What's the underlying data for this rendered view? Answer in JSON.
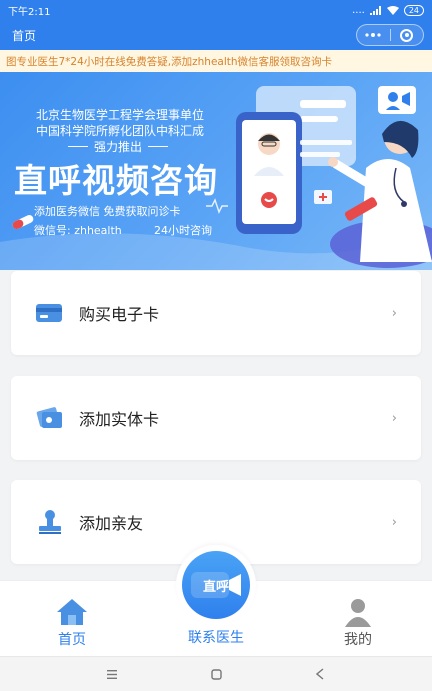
{
  "status_bar": {
    "time": "下午2:11",
    "signal": "....",
    "battery": "24"
  },
  "nav": {
    "title": "首页",
    "menu_label": "•••"
  },
  "marquee": {
    "text": "图专业医生7*24小时在线免费答疑,添加zhhealth微信客服领取咨询卡"
  },
  "banner": {
    "line1": "北京生物医学工程学会理事单位",
    "line2": "中国科学院所孵化团队中科汇成",
    "subtitle": "强力推出",
    "title": "直呼视频咨询",
    "line3": "添加医务微信 免费获取问诊卡",
    "line4": "微信号: zhhealth",
    "line5": "24小时咨询"
  },
  "menu": [
    {
      "label": "购买电子卡",
      "icon": "credit-card-icon"
    },
    {
      "label": "添加实体卡",
      "icon": "physical-card-icon"
    },
    {
      "label": "添加亲友",
      "icon": "stamp-icon"
    }
  ],
  "chevron": "›",
  "tabbar": {
    "home": "首页",
    "doctor": "联系医生",
    "doctor_badge": "直呼",
    "mine": "我的"
  },
  "colors": {
    "primary": "#2f80ed",
    "marquee_text": "#d7822c",
    "marquee_bg": "#fff7e1"
  }
}
